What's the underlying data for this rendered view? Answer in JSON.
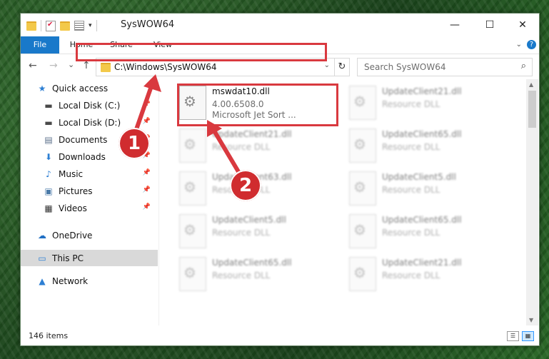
{
  "window": {
    "title": "SysWOW64",
    "minimize": "—",
    "maximize": "☐",
    "close": "✕"
  },
  "ribbon": {
    "tabs": [
      "File",
      "Home",
      "Share",
      "View"
    ],
    "help": "?"
  },
  "nav": {
    "back": "←",
    "forward": "→",
    "recent": "⌄",
    "up": "↑",
    "address": "C:\\Windows\\SysWOW64",
    "refresh": "↻",
    "search_placeholder": "Search SysWOW64",
    "search_icon": "⌕"
  },
  "sidebar": {
    "items": [
      {
        "label": "Quick access",
        "icon": "star-icon",
        "glyph": "★",
        "color": "#2d7fd3"
      },
      {
        "label": "Local Disk (C:)",
        "icon": "drive-icon",
        "glyph": "▬",
        "color": "#4a4a4a"
      },
      {
        "label": "Local Disk (D:)",
        "icon": "drive-icon",
        "glyph": "▬",
        "color": "#4a4a4a"
      },
      {
        "label": "Documents",
        "icon": "documents-icon",
        "glyph": "▤",
        "color": "#5b6f8a"
      },
      {
        "label": "Downloads",
        "icon": "download-icon",
        "glyph": "⬇",
        "color": "#2d7fd3"
      },
      {
        "label": "Music",
        "icon": "music-icon",
        "glyph": "♪",
        "color": "#2d7fd3"
      },
      {
        "label": "Pictures",
        "icon": "pictures-icon",
        "glyph": "▣",
        "color": "#4a7aa8"
      },
      {
        "label": "Videos",
        "icon": "videos-icon",
        "glyph": "▦",
        "color": "#333"
      },
      {
        "label": "OneDrive",
        "icon": "cloud-icon",
        "glyph": "☁",
        "color": "#1f6fc4"
      },
      {
        "label": "This PC",
        "icon": "computer-icon",
        "glyph": "▭",
        "color": "#2d7fd3"
      },
      {
        "label": "Network",
        "icon": "network-icon",
        "glyph": "▲",
        "color": "#2d7fd3"
      }
    ],
    "pin_glyph": "📌"
  },
  "files": [
    {
      "name": "mswdat10.dll",
      "line2": "4.00.6508.0",
      "line3": "Microsoft Jet Sort ..."
    },
    {
      "name": "UpdateClient21.dll",
      "line2": "Resource DLL"
    },
    {
      "name": "UpdateClient21.dll",
      "line2": "Resource DLL"
    },
    {
      "name": "UpdateClient65.dll",
      "line2": "Resource DLL"
    },
    {
      "name": "UpdateClient63.dll",
      "line2": "Resource DLL"
    },
    {
      "name": "UpdateClient5.dll",
      "line2": "Resource DLL"
    },
    {
      "name": "UpdateClient5.dll",
      "line2": "Resource DLL"
    },
    {
      "name": "UpdateClient65.dll",
      "line2": "Resource DLL"
    },
    {
      "name": "UpdateClient65.dll",
      "line2": "Resource DLL"
    },
    {
      "name": "UpdateClient21.dll",
      "line2": "Resource DLL"
    }
  ],
  "status": {
    "count": "146 items"
  },
  "annotations": {
    "badge1": "1",
    "badge2": "2",
    "color": "#d9393f"
  }
}
